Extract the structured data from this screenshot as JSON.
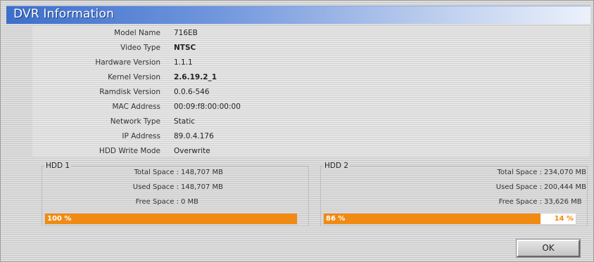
{
  "window": {
    "title": "DVR Information"
  },
  "info": [
    {
      "label": "Model Name",
      "value": "716EB"
    },
    {
      "label": "Video Type",
      "value": "NTSC"
    },
    {
      "label": "Hardware Version",
      "value": "1.1.1"
    },
    {
      "label": "Kernel Version",
      "value": "2.6.19.2_1"
    },
    {
      "label": "Ramdisk Version",
      "value": "0.0.6-546"
    },
    {
      "label": "MAC Address",
      "value": "00:09:f8:00:00:00"
    },
    {
      "label": "Network Type",
      "value": "Static"
    },
    {
      "label": "IP Address",
      "value": "89.0.4.176"
    },
    {
      "label": "HDD Write Mode",
      "value": "Overwrite"
    }
  ],
  "hdd": [
    {
      "title": "HDD 1",
      "total_label": "Total Space :",
      "total_value": "148,707  MB",
      "used_label": "Used Space :",
      "used_value": "148,707  MB",
      "free_label": "Free Space :",
      "free_value": "0  MB",
      "used_percent": 100,
      "used_percent_label": "100 %",
      "free_percent_label": ""
    },
    {
      "title": "HDD 2",
      "total_label": "Total Space :",
      "total_value": "234,070  MB",
      "used_label": "Used Space :",
      "used_value": "200,444  MB",
      "free_label": "Free Space :",
      "free_value": "33,626  MB",
      "used_percent": 86,
      "used_percent_label": "86 %",
      "free_percent_label": "14 %"
    }
  ],
  "buttons": {
    "ok_label": "OK"
  },
  "colors": {
    "bar_fill": "#f08a12",
    "title_bar": "#3d6fcb"
  }
}
